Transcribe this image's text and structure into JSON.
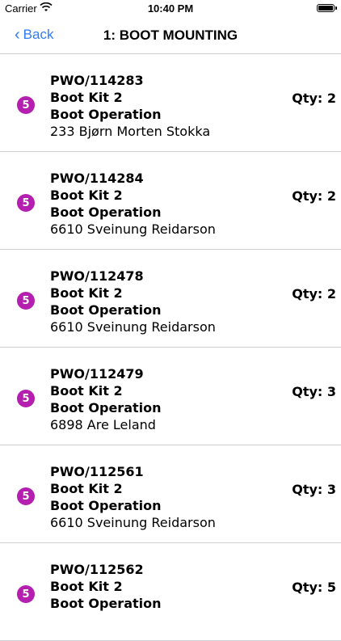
{
  "status_bar": {
    "carrier": "Carrier",
    "time": "10:40 PM"
  },
  "nav": {
    "back_label": "Back",
    "title": "1: BOOT MOUNTING"
  },
  "rows": [
    {
      "order": "PWO/114283",
      "kit": "Boot Kit 2",
      "operation": "Boot Operation",
      "worker": "233 Bjørn Morten Stokka",
      "qty": "Qty: 2",
      "badge": "5"
    },
    {
      "order": "PWO/114284",
      "kit": "Boot Kit 2",
      "operation": "Boot Operation",
      "worker": "6610 Sveinung Reidarson",
      "qty": "Qty: 2",
      "badge": "5"
    },
    {
      "order": "PWO/112478",
      "kit": "Boot Kit 2",
      "operation": "Boot Operation",
      "worker": "6610 Sveinung Reidarson",
      "qty": "Qty: 2",
      "badge": "5"
    },
    {
      "order": "PWO/112479",
      "kit": "Boot Kit 2",
      "operation": "Boot Operation",
      "worker": "6898 Are Leland",
      "qty": "Qty: 3",
      "badge": "5"
    },
    {
      "order": "PWO/112561",
      "kit": "Boot Kit 2",
      "operation": "Boot Operation",
      "worker": "6610 Sveinung Reidarson",
      "qty": "Qty: 3",
      "badge": "5"
    },
    {
      "order": "PWO/112562",
      "kit": "Boot Kit 2",
      "operation": "Boot Operation",
      "worker": "",
      "qty": "Qty: 5",
      "badge": "5"
    }
  ],
  "colors": {
    "accent": "#2f7bf6",
    "badge": "#b51fb0",
    "separator": "#cfcfd4"
  }
}
